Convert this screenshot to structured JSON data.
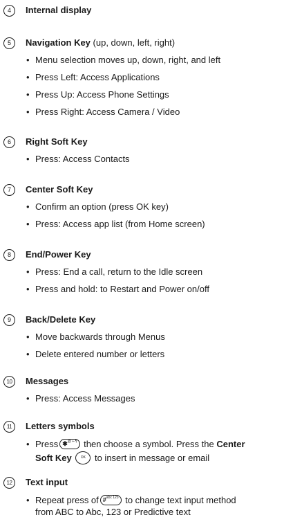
{
  "sections": [
    {
      "number": "4",
      "title": "Internal display",
      "title_suffix": "",
      "items": []
    },
    {
      "number": "5",
      "title": "Navigation Key",
      "title_suffix": " (up, down, left, right)",
      "items": [
        "Menu selection moves up, down, right, and left",
        "Press Left: Access Applications",
        "Press Up: Access Phone Settings",
        "Press Right: Access Camera / Video"
      ]
    },
    {
      "number": "6",
      "title": "Right Soft Key",
      "title_suffix": "",
      "items": [
        "Press: Access Contacts"
      ]
    },
    {
      "number": "7",
      "title": "Center Soft Key",
      "title_suffix": "",
      "items": [
        "Confirm an option (press OK key)",
        "Press: Access app list (from Home screen)"
      ]
    },
    {
      "number": "8",
      "title": "End/Power Key",
      "title_suffix": "",
      "items": [
        "Press: End a call, return to the Idle screen",
        "Press and hold: to Restart and Power on/off"
      ]
    },
    {
      "number": "9",
      "title": "Back/Delete Key",
      "title_suffix": "",
      "items": [
        "Move backwards through Menus",
        "Delete entered number or letters"
      ]
    },
    {
      "number": "10",
      "title": "Messages",
      "title_suffix": "",
      "items": [
        "Press: Access Messages"
      ]
    },
    {
      "number": "11",
      "title": "Letters symbols",
      "title_suffix": "",
      "items": []
    },
    {
      "number": "12",
      "title": "Text input",
      "title_suffix": "",
      "items": []
    }
  ],
  "letters_symbols_item": {
    "press": "Press",
    "star_key": "✱",
    "star_key_sup": "@ +-¶",
    "mid": " then choose a symbol. Press the ",
    "center_bold": "Center",
    "soft_key_bold": "Soft Key",
    "ok_key": "OK",
    "end": " to insert in message or email"
  },
  "text_input_item": {
    "repeat": "Repeat press of",
    "hash_key": "#",
    "hash_key_sup": "abc 123",
    "mid": " to change text input method",
    "line2": "from ABC to Abc, 123 or Predictive text"
  }
}
